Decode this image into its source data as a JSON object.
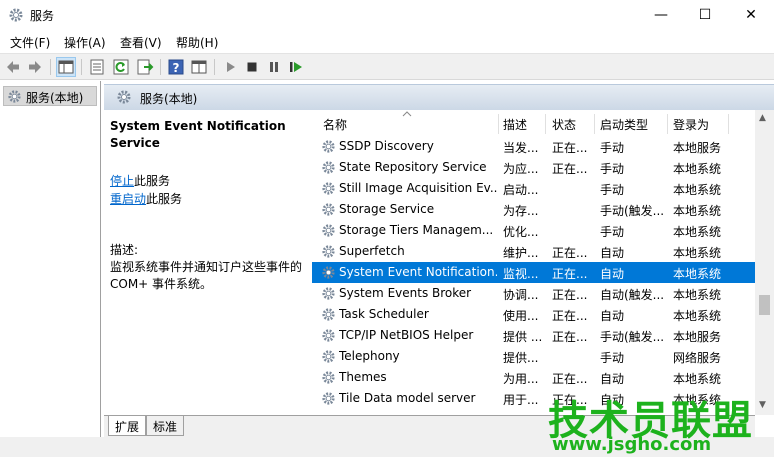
{
  "window": {
    "title": "服务",
    "minimize": "—",
    "maximize": "☐",
    "close": "✕"
  },
  "menu": [
    "文件(F)",
    "操作(A)",
    "查看(V)",
    "帮助(H)"
  ],
  "tree": {
    "item": "服务(本地)"
  },
  "pane_header": "服务(本地)",
  "detail": {
    "title": "System Event Notification Service",
    "stop_link": "停止",
    "stop_suffix": "此服务",
    "restart_link": "重启动",
    "restart_suffix": "此服务",
    "desc_label": "描述:",
    "desc_line1": "监视系统事件并通知订户这些事件的",
    "desc_line2": "COM+ 事件系统。"
  },
  "columns": [
    "名称",
    "描述",
    "状态",
    "启动类型",
    "登录为"
  ],
  "rows": [
    {
      "name": "SSDP Discovery",
      "desc": "当发...",
      "status": "正在...",
      "startup": "手动",
      "logon": "本地服务"
    },
    {
      "name": "State Repository Service",
      "desc": "为应...",
      "status": "正在...",
      "startup": "手动",
      "logon": "本地系统"
    },
    {
      "name": "Still Image Acquisition Ev...",
      "desc": "启动...",
      "status": "",
      "startup": "手动",
      "logon": "本地系统"
    },
    {
      "name": "Storage Service",
      "desc": "为存...",
      "status": "",
      "startup": "手动(触发...",
      "logon": "本地系统"
    },
    {
      "name": "Storage Tiers Managem...",
      "desc": "优化...",
      "status": "",
      "startup": "手动",
      "logon": "本地系统"
    },
    {
      "name": "Superfetch",
      "desc": "维护...",
      "status": "正在...",
      "startup": "自动",
      "logon": "本地系统"
    },
    {
      "name": "System Event Notification...",
      "desc": "监视...",
      "status": "正在...",
      "startup": "自动",
      "logon": "本地系统"
    },
    {
      "name": "System Events Broker",
      "desc": "协调...",
      "status": "正在...",
      "startup": "自动(触发...",
      "logon": "本地系统"
    },
    {
      "name": "Task Scheduler",
      "desc": "使用...",
      "status": "正在...",
      "startup": "自动",
      "logon": "本地系统"
    },
    {
      "name": "TCP/IP NetBIOS Helper",
      "desc": "提供 ...",
      "status": "正在...",
      "startup": "手动(触发...",
      "logon": "本地服务"
    },
    {
      "name": "Telephony",
      "desc": "提供...",
      "status": "",
      "startup": "手动",
      "logon": "网络服务"
    },
    {
      "name": "Themes",
      "desc": "为用...",
      "status": "正在...",
      "startup": "自动",
      "logon": "本地系统"
    },
    {
      "name": "Tile Data model server",
      "desc": "用于...",
      "status": "正在...",
      "startup": "自动",
      "logon": "本地系统"
    }
  ],
  "selected_index": 6,
  "tabs": [
    "扩展",
    "标准"
  ],
  "watermark": {
    "text": "技术员联盟",
    "url": "www.jsgho.com"
  },
  "icons": [
    "services-gear-icon",
    "back-arrow-icon",
    "forward-arrow-icon",
    "show-hide-tree-icon",
    "properties-icon",
    "refresh-icon",
    "export-list-icon",
    "help-icon",
    "console-tree-icon",
    "play-icon",
    "stop-icon",
    "pause-icon",
    "restart-icon"
  ],
  "colors": {
    "selection": "#0078d7",
    "link": "#0066cc",
    "watermark": "#1db21d"
  }
}
